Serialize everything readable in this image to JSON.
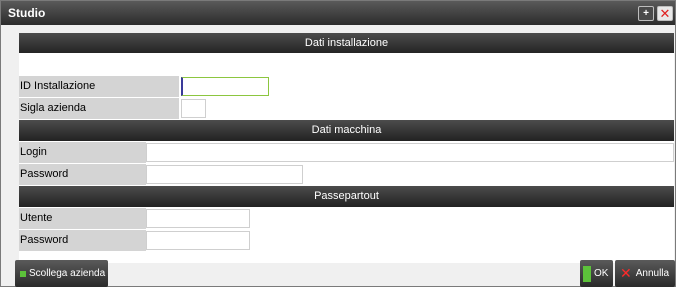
{
  "window": {
    "title": "Studio"
  },
  "titlebar": {
    "expand_icon": "expand-icon",
    "close_icon": "close-icon"
  },
  "sections": {
    "installazione": "Dati installazione",
    "macchina": "Dati macchina",
    "passepartout": "Passepartout"
  },
  "fields": {
    "id_installazione": {
      "label": "ID Installazione",
      "value": ""
    },
    "sigla_azienda": {
      "label": "Sigla azienda",
      "value": ""
    },
    "login": {
      "label": "Login",
      "value": ""
    },
    "password_macchina": {
      "label": "Password",
      "value": ""
    },
    "utente": {
      "label": "Utente",
      "value": ""
    },
    "password_passepartout": {
      "label": "Password",
      "value": ""
    }
  },
  "buttons": {
    "scollega": "Scollega azienda",
    "ok": "OK",
    "annulla": "Annulla"
  },
  "colors": {
    "accent_green": "#5cc23a",
    "close_red": "#e02020",
    "header_dark": "#2b2b2b"
  }
}
